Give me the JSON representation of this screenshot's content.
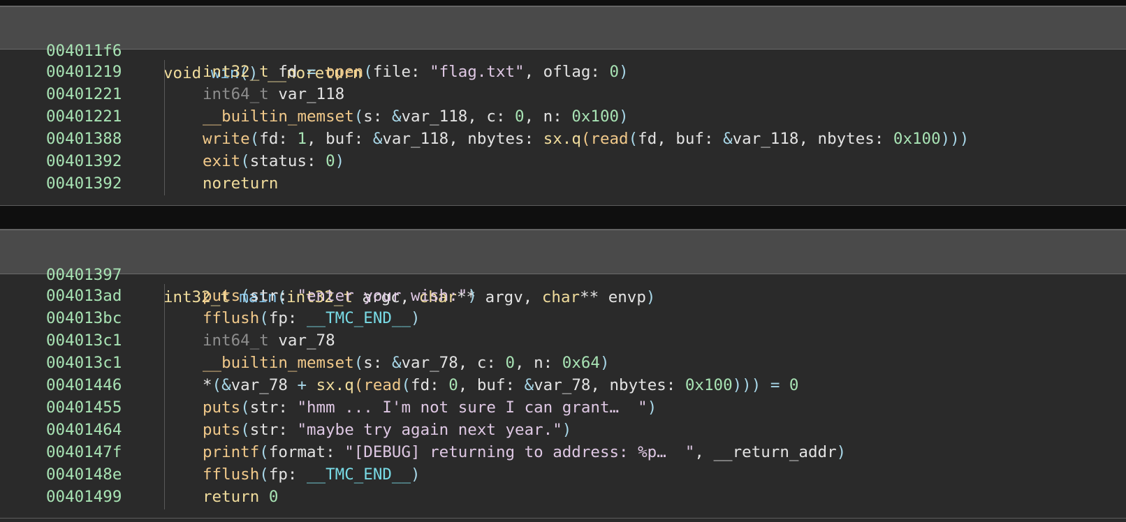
{
  "functions": [
    {
      "header": {
        "address": "004011f6",
        "tokens": [
          {
            "t": "void ",
            "c": "kw"
          },
          {
            "t": "win",
            "c": "fnn"
          },
          {
            "t": "()",
            "c": "pun"
          },
          {
            "t": " __noreturn",
            "c": "kw"
          }
        ]
      },
      "lines": [
        {
          "address": "00401219",
          "tokens": [
            {
              "t": "int32_t ",
              "c": "kw"
            },
            {
              "t": "fd ",
              "c": "txt"
            },
            {
              "t": "=",
              "c": "op"
            },
            {
              "t": " ",
              "c": "txt"
            },
            {
              "t": "open",
              "c": "cal"
            },
            {
              "t": "(",
              "c": "pun"
            },
            {
              "t": "file: ",
              "c": "txt"
            },
            {
              "t": "\"flag.txt\"",
              "c": "str"
            },
            {
              "t": ", oflag: ",
              "c": "txt"
            },
            {
              "t": "0",
              "c": "num"
            },
            {
              "t": ")",
              "c": "pun"
            }
          ]
        },
        {
          "address": "00401221",
          "tokens": [
            {
              "t": "int64_t ",
              "c": "tyd"
            },
            {
              "t": "var_118",
              "c": "txt"
            }
          ]
        },
        {
          "address": "00401221",
          "tokens": [
            {
              "t": "__builtin_memset",
              "c": "cal"
            },
            {
              "t": "(",
              "c": "pun"
            },
            {
              "t": "s: ",
              "c": "txt"
            },
            {
              "t": "&",
              "c": "op"
            },
            {
              "t": "var_118, c: ",
              "c": "txt"
            },
            {
              "t": "0",
              "c": "num"
            },
            {
              "t": ", n: ",
              "c": "txt"
            },
            {
              "t": "0x100",
              "c": "num"
            },
            {
              "t": ")",
              "c": "pun"
            }
          ]
        },
        {
          "address": "00401388",
          "tokens": [
            {
              "t": "write",
              "c": "cal"
            },
            {
              "t": "(",
              "c": "pun"
            },
            {
              "t": "fd: ",
              "c": "txt"
            },
            {
              "t": "1",
              "c": "num"
            },
            {
              "t": ", buf: ",
              "c": "txt"
            },
            {
              "t": "&",
              "c": "op"
            },
            {
              "t": "var_118, nbytes: ",
              "c": "txt"
            },
            {
              "t": "sx.q",
              "c": "kw"
            },
            {
              "t": "(",
              "c": "cal"
            },
            {
              "t": "read",
              "c": "cal"
            },
            {
              "t": "(",
              "c": "pun"
            },
            {
              "t": "fd, buf: ",
              "c": "txt"
            },
            {
              "t": "&",
              "c": "op"
            },
            {
              "t": "var_118, nbytes: ",
              "c": "txt"
            },
            {
              "t": "0x100",
              "c": "num"
            },
            {
              "t": ")))",
              "c": "pun"
            }
          ]
        },
        {
          "address": "00401392",
          "tokens": [
            {
              "t": "exit",
              "c": "cal"
            },
            {
              "t": "(",
              "c": "pun"
            },
            {
              "t": "status: ",
              "c": "txt"
            },
            {
              "t": "0",
              "c": "num"
            },
            {
              "t": ")",
              "c": "pun"
            }
          ]
        },
        {
          "address": "00401392",
          "tokens": [
            {
              "t": "noreturn",
              "c": "kw"
            }
          ]
        }
      ]
    },
    {
      "header": {
        "address": "00401397",
        "tokens": [
          {
            "t": "int32_t ",
            "c": "kw"
          },
          {
            "t": "main",
            "c": "fnn"
          },
          {
            "t": "(",
            "c": "pun"
          },
          {
            "t": "int32_t ",
            "c": "kw"
          },
          {
            "t": "argc, ",
            "c": "txt"
          },
          {
            "t": "char",
            "c": "kw"
          },
          {
            "t": "** argv, ",
            "c": "txt"
          },
          {
            "t": "char",
            "c": "kw"
          },
          {
            "t": "** envp",
            "c": "txt"
          },
          {
            "t": ")",
            "c": "pun"
          }
        ]
      },
      "lines": [
        {
          "address": "004013ad",
          "tokens": [
            {
              "t": "puts",
              "c": "cal"
            },
            {
              "t": "(",
              "c": "pun"
            },
            {
              "t": "str: ",
              "c": "txt"
            },
            {
              "t": "\"enter your wish:\"",
              "c": "str"
            },
            {
              "t": ")",
              "c": "pun"
            }
          ]
        },
        {
          "address": "004013bc",
          "tokens": [
            {
              "t": "fflush",
              "c": "cal"
            },
            {
              "t": "(",
              "c": "pun"
            },
            {
              "t": "fp: ",
              "c": "txt"
            },
            {
              "t": "__TMC_END__",
              "c": "sym"
            },
            {
              "t": ")",
              "c": "pun"
            }
          ]
        },
        {
          "address": "004013c1",
          "tokens": [
            {
              "t": "int64_t ",
              "c": "tyd"
            },
            {
              "t": "var_78",
              "c": "txt"
            }
          ]
        },
        {
          "address": "004013c1",
          "tokens": [
            {
              "t": "__builtin_memset",
              "c": "cal"
            },
            {
              "t": "(",
              "c": "pun"
            },
            {
              "t": "s: ",
              "c": "txt"
            },
            {
              "t": "&",
              "c": "op"
            },
            {
              "t": "var_78, c: ",
              "c": "txt"
            },
            {
              "t": "0",
              "c": "num"
            },
            {
              "t": ", n: ",
              "c": "txt"
            },
            {
              "t": "0x64",
              "c": "num"
            },
            {
              "t": ")",
              "c": "pun"
            }
          ]
        },
        {
          "address": "00401446",
          "tokens": [
            {
              "t": "*",
              "c": "txt"
            },
            {
              "t": "(",
              "c": "pun"
            },
            {
              "t": "&",
              "c": "op"
            },
            {
              "t": "var_78 ",
              "c": "txt"
            },
            {
              "t": "+",
              "c": "op"
            },
            {
              "t": " ",
              "c": "txt"
            },
            {
              "t": "sx.q",
              "c": "kw"
            },
            {
              "t": "(",
              "c": "cal"
            },
            {
              "t": "read",
              "c": "cal"
            },
            {
              "t": "(",
              "c": "pun"
            },
            {
              "t": "fd: ",
              "c": "txt"
            },
            {
              "t": "0",
              "c": "num"
            },
            {
              "t": ", buf: ",
              "c": "txt"
            },
            {
              "t": "&",
              "c": "op"
            },
            {
              "t": "var_78, nbytes: ",
              "c": "txt"
            },
            {
              "t": "0x100",
              "c": "num"
            },
            {
              "t": ")))",
              "c": "pun"
            },
            {
              "t": " ",
              "c": "txt"
            },
            {
              "t": "=",
              "c": "op"
            },
            {
              "t": " ",
              "c": "txt"
            },
            {
              "t": "0",
              "c": "num"
            }
          ]
        },
        {
          "address": "00401455",
          "tokens": [
            {
              "t": "puts",
              "c": "cal"
            },
            {
              "t": "(",
              "c": "pun"
            },
            {
              "t": "str: ",
              "c": "txt"
            },
            {
              "t": "\"hmm ... I'm not sure I can grant…  \"",
              "c": "str"
            },
            {
              "t": ")",
              "c": "pun"
            }
          ]
        },
        {
          "address": "00401464",
          "tokens": [
            {
              "t": "puts",
              "c": "cal"
            },
            {
              "t": "(",
              "c": "pun"
            },
            {
              "t": "str: ",
              "c": "txt"
            },
            {
              "t": "\"maybe try again next year.\"",
              "c": "str"
            },
            {
              "t": ")",
              "c": "pun"
            }
          ]
        },
        {
          "address": "0040147f",
          "tokens": [
            {
              "t": "printf",
              "c": "cal"
            },
            {
              "t": "(",
              "c": "pun"
            },
            {
              "t": "format: ",
              "c": "txt"
            },
            {
              "t": "\"[DEBUG] returning to address: %p…  \"",
              "c": "str"
            },
            {
              "t": ", __return_addr",
              "c": "txt"
            },
            {
              "t": ")",
              "c": "pun"
            }
          ]
        },
        {
          "address": "0040148e",
          "tokens": [
            {
              "t": "fflush",
              "c": "cal"
            },
            {
              "t": "(",
              "c": "pun"
            },
            {
              "t": "fp: ",
              "c": "txt"
            },
            {
              "t": "__TMC_END__",
              "c": "sym"
            },
            {
              "t": ")",
              "c": "pun"
            }
          ]
        },
        {
          "address": "00401499",
          "tokens": [
            {
              "t": "return ",
              "c": "kw"
            },
            {
              "t": "0",
              "c": "num"
            }
          ]
        }
      ]
    }
  ]
}
